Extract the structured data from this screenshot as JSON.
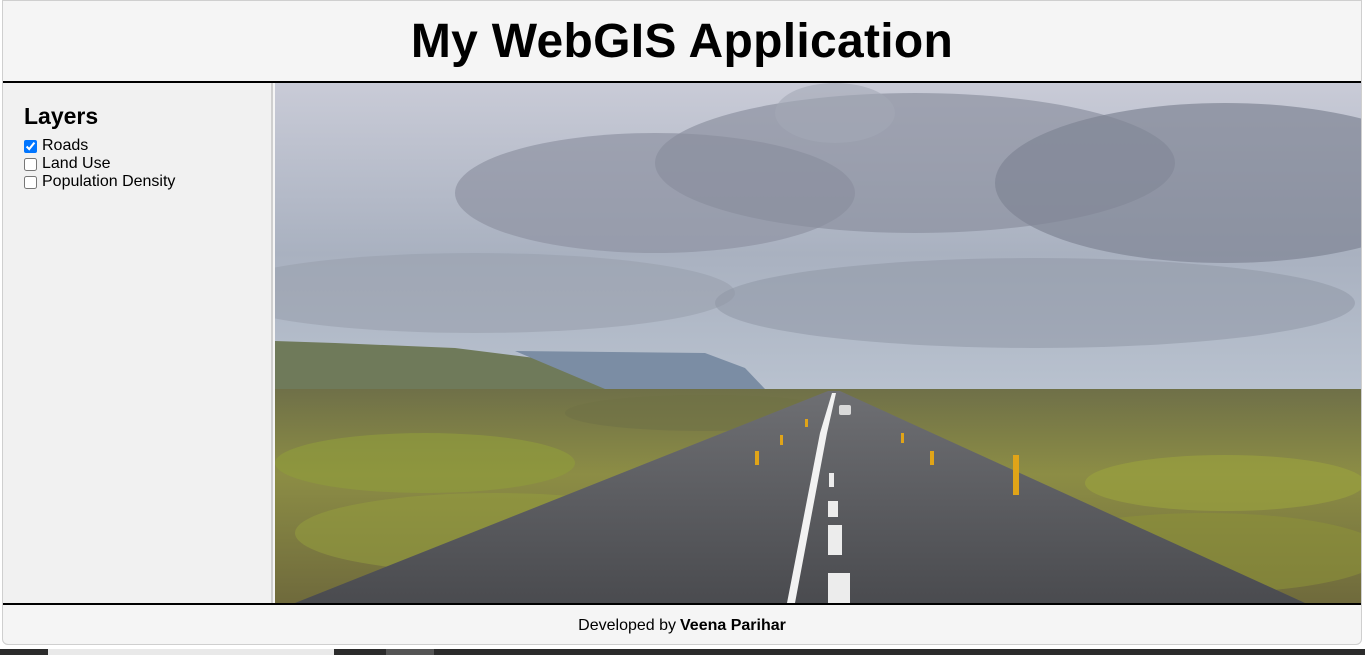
{
  "header": {
    "title": "My WebGIS Application"
  },
  "sidebar": {
    "title": "Layers",
    "layers": [
      {
        "label": "Roads",
        "checked": true
      },
      {
        "label": "Land Use",
        "checked": false
      },
      {
        "label": "Population Density",
        "checked": false
      }
    ]
  },
  "footer": {
    "prefix": "Developed by",
    "author": "Veena Parihar"
  },
  "map": {
    "image": "road-landscape-photo"
  }
}
